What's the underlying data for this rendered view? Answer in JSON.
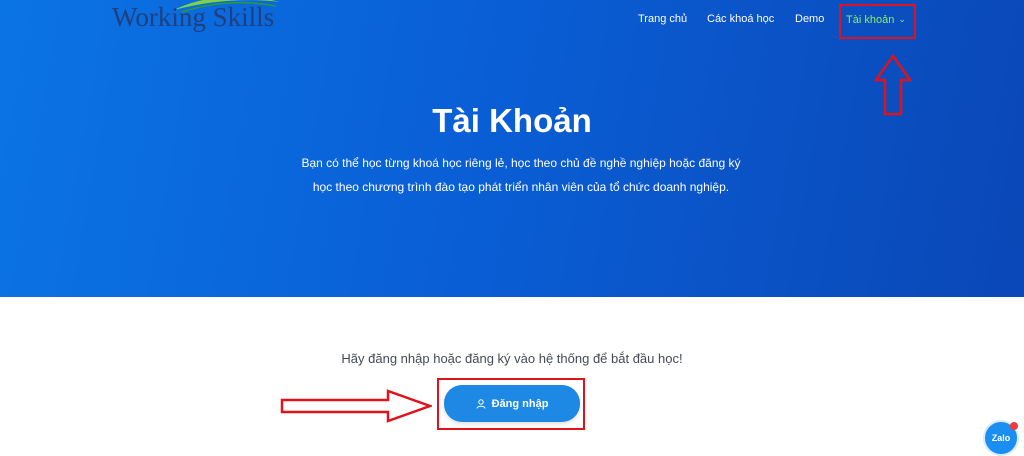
{
  "brand": {
    "logo_text": "Working Skills"
  },
  "nav": {
    "items": [
      {
        "label": "Trang chủ"
      },
      {
        "label": "Các khoá học"
      },
      {
        "label": "Demo"
      },
      {
        "label": "Tài khoản",
        "active": true
      }
    ]
  },
  "hero": {
    "title": "Tài Khoản",
    "description": "Bạn có thể học từng khoá học riêng lẻ, học theo chủ đề nghề nghiệp hoặc đăng ký học theo chương trình đào tạo phát triển nhân viên của tổ chức doanh nghiệp."
  },
  "main": {
    "prompt": "Hãy đăng nhập hoặc đăng ký vào hệ thống để bắt đầu học!",
    "login_label": "Đăng nhập"
  },
  "chat_widget": {
    "label": "Zalo"
  },
  "colors": {
    "hero_start": "#0b74e4",
    "hero_end": "#0a47b7",
    "active_nav": "#8df25a",
    "button": "#1e88e5",
    "annotation": "#e0131c"
  },
  "icons": [
    "chevron-down-icon",
    "user-icon",
    "up-arrow-annotation",
    "right-arrow-annotation",
    "zalo-icon"
  ]
}
